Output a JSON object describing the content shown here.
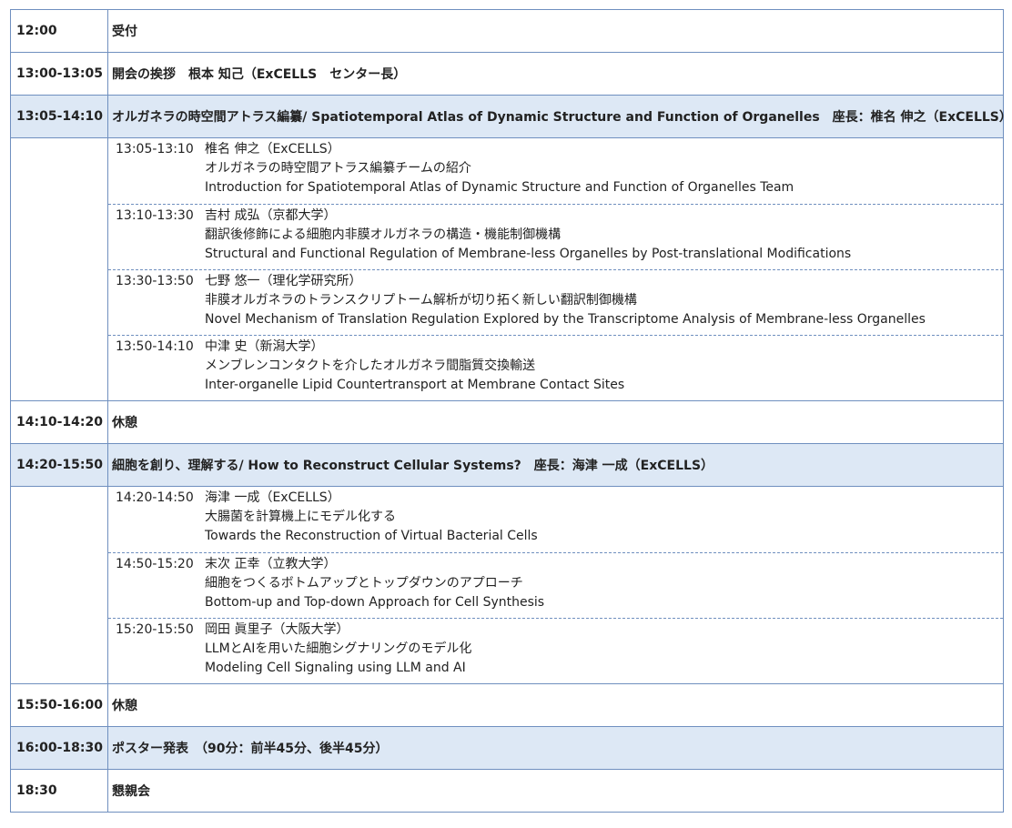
{
  "schedule": [
    {
      "kind": "main",
      "time": "12:00",
      "title": "受付"
    },
    {
      "kind": "main",
      "time": "13:00-13:05",
      "title": "開会の挨拶　根本 知己（ExCELLS　センター長）"
    },
    {
      "kind": "session",
      "time": "13:05-14:10",
      "title": "オルガネラの時空間アトラス編纂/ Spatiotemporal Atlas of Dynamic Structure and Function of Organelles　座長：椎名 伸之（ExCELLS）",
      "talks": [
        {
          "time": "13:05-13:10",
          "speaker": "椎名 伸之（ExCELLS）",
          "title_ja": "オルガネラの時空間アトラス編纂チームの紹介",
          "title_en": "Introduction for Spatiotemporal Atlas of Dynamic Structure and Function of Organelles Team"
        },
        {
          "time": "13:10-13:30",
          "speaker": "吉村 成弘（京都大学）",
          "title_ja": "翻訳後修飾による細胞内非膜オルガネラの構造・機能制御機構",
          "title_en": "Structural and Functional Regulation of Membrane-less Organelles by Post-translational Modifications"
        },
        {
          "time": "13:30-13:50",
          "speaker": "七野 悠一（理化学研究所）",
          "title_ja": "非膜オルガネラのトランスクリプトーム解析が切り拓く新しい翻訳制御機構",
          "title_en": "Novel Mechanism of Translation Regulation Explored by the Transcriptome Analysis of Membrane-less Organelles"
        },
        {
          "time": "13:50-14:10",
          "speaker": "中津 史（新潟大学）",
          "title_ja": "メンブレンコンタクトを介したオルガネラ間脂質交換輸送",
          "title_en": "Inter-organelle Lipid Countertransport at Membrane Contact Sites"
        }
      ]
    },
    {
      "kind": "main",
      "time": "14:10-14:20",
      "title": "休憩"
    },
    {
      "kind": "session",
      "time": "14:20-15:50",
      "title": "細胞を創り、理解する/ How to Reconstruct Cellular Systems?　座長：海津 一成（ExCELLS）",
      "talks": [
        {
          "time": "14:20-14:50",
          "speaker": "海津 一成（ExCELLS）",
          "title_ja": "大腸菌を計算機上にモデル化する",
          "title_en": "Towards the Reconstruction of Virtual Bacterial Cells"
        },
        {
          "time": "14:50-15:20",
          "speaker": "末次 正幸（立教大学）",
          "title_ja": "細胞をつくるボトムアップとトップダウンのアプローチ",
          "title_en": "Bottom-up and Top-down Approach for Cell Synthesis"
        },
        {
          "time": "15:20-15:50",
          "speaker": "岡田 眞里子（大阪大学）",
          "title_ja": "LLMとAIを用いた細胞シグナリングのモデル化",
          "title_en": "Modeling Cell Signaling using LLM and AI"
        }
      ]
    },
    {
      "kind": "main",
      "time": "15:50-16:00",
      "title": "休憩"
    },
    {
      "kind": "session-plain",
      "time": "16:00-18:30",
      "title": "ポスター発表　（90分：前半45分、後半45分）"
    },
    {
      "kind": "main",
      "time": "18:30",
      "title": "懇親会"
    }
  ],
  "colors": {
    "border": "#6f8fbf",
    "session_bg": "#dde8f5"
  }
}
